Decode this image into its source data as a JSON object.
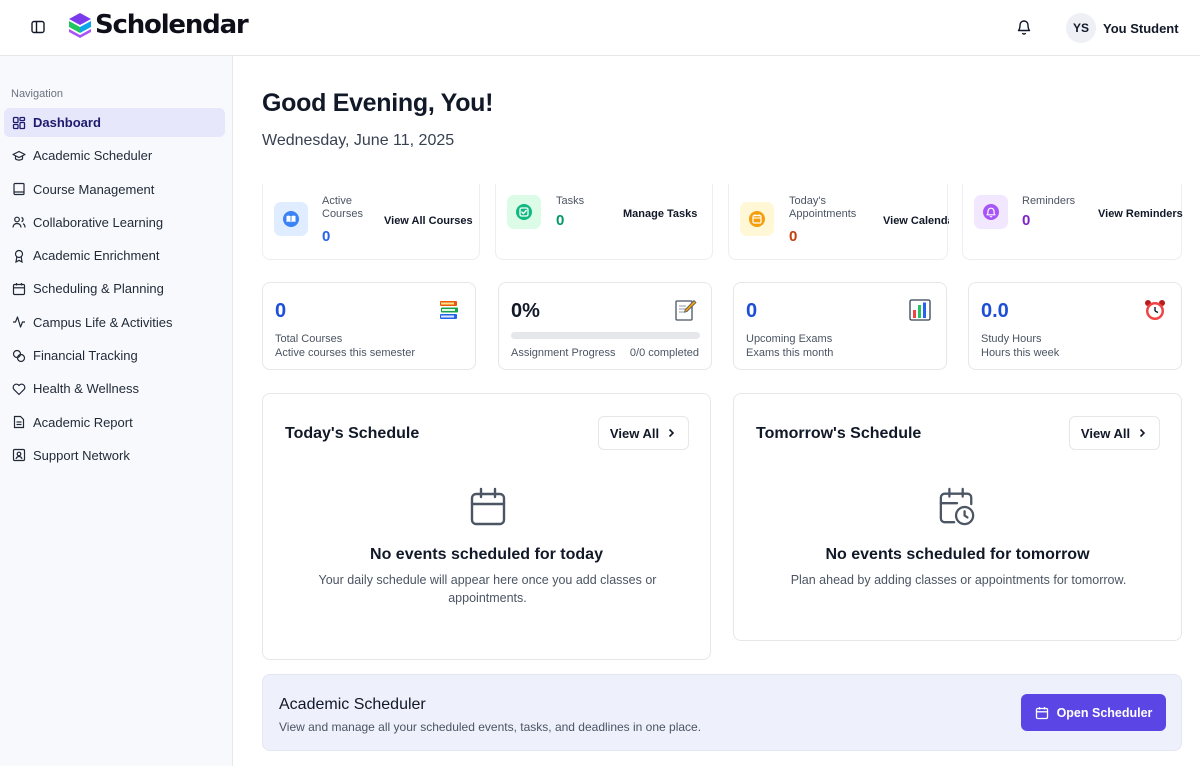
{
  "header": {
    "app_name": "Scholendar",
    "user_initials": "YS",
    "user_name": "You Student"
  },
  "sidebar": {
    "heading": "Navigation",
    "items": [
      {
        "label": "Dashboard",
        "icon": "grid-icon",
        "active": true
      },
      {
        "label": "Academic Scheduler",
        "icon": "graduation-cap-icon"
      },
      {
        "label": "Course Management",
        "icon": "book-icon"
      },
      {
        "label": "Collaborative Learning",
        "icon": "users-icon"
      },
      {
        "label": "Academic Enrichment",
        "icon": "award-icon"
      },
      {
        "label": "Scheduling & Planning",
        "icon": "calendar-icon"
      },
      {
        "label": "Campus Life & Activities",
        "icon": "activity-icon"
      },
      {
        "label": "Financial Tracking",
        "icon": "coins-icon"
      },
      {
        "label": "Health & Wellness",
        "icon": "heart-icon"
      },
      {
        "label": "Academic Report",
        "icon": "file-text-icon"
      },
      {
        "label": "Support Network",
        "icon": "contact-icon"
      }
    ]
  },
  "main": {
    "greeting": "Good Evening, You!",
    "date": "Wednesday, June 11, 2025",
    "quick_cards": [
      {
        "label_line1": "Active",
        "label_line2": "Courses",
        "value": "0",
        "link": "View All Courses",
        "color": "#2563eb"
      },
      {
        "label_line1": "Tasks",
        "label_line2": "",
        "value": "0",
        "link": "Manage Tasks",
        "color": "#059669"
      },
      {
        "label_line1": "Today's",
        "label_line2": "Appointments",
        "value": "0",
        "link": "View Calendar",
        "color": "#c2410c"
      },
      {
        "label_line1": "Reminders",
        "label_line2": "",
        "value": "0",
        "link": "View Reminders",
        "color": "#7e22ce"
      }
    ],
    "stats": [
      {
        "value": "0",
        "label": "Total Courses",
        "sub": "Active courses this semester",
        "value_color": "#1d4ed8"
      },
      {
        "value": "0%",
        "label": "Assignment Progress",
        "sub": "0/0 completed",
        "progress": 0,
        "value_color": "#111827"
      },
      {
        "value": "0",
        "label": "Upcoming Exams",
        "sub": "Exams this month",
        "value_color": "#1d4ed8"
      },
      {
        "value": "0.0",
        "label": "Study Hours",
        "sub": "Hours this week",
        "value_color": "#1d4ed8"
      }
    ],
    "today": {
      "title": "Today's Schedule",
      "view_all": "View All",
      "empty_title": "No events scheduled for today",
      "empty_sub": "Your daily schedule will appear here once you add classes or appointments."
    },
    "tomorrow": {
      "title": "Tomorrow's Schedule",
      "view_all": "View All",
      "empty_title": "No events scheduled for tomorrow",
      "empty_sub": "Plan ahead by adding classes or appointments for tomorrow."
    },
    "banner": {
      "title": "Academic Scheduler",
      "subtitle": "View and manage all your scheduled events, tasks, and deadlines in one place.",
      "button": "Open Scheduler"
    }
  }
}
